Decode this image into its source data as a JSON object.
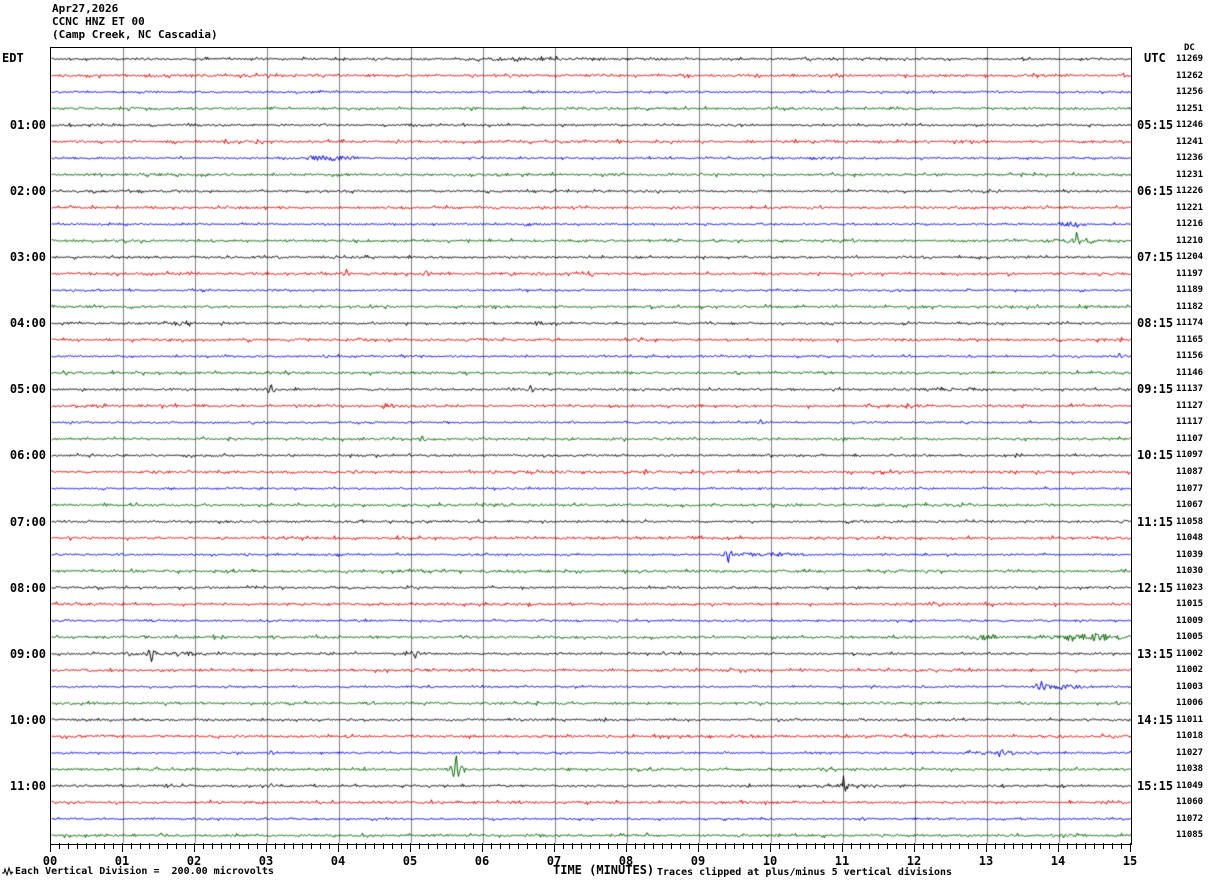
{
  "header": {
    "date": "Apr27,2026",
    "station": "CCNC HNZ ET 00",
    "location": "(Camp Creek, NC Cascadia)"
  },
  "axis": {
    "left_header": "EDT",
    "right_header": "UTC",
    "dc_header": "DC",
    "x_label": "TIME (MINUTES)",
    "footer_scale": "Each Vertical Division =  200.00 microvolts",
    "footer_clip": "Traces clipped at plus/minus 5 vertical divisions"
  },
  "chart_data": {
    "type": "line",
    "subtype": "helicorder-seismogram",
    "title": "CCNC HNZ ET 00 (Camp Creek, NC Cascadia) Apr27,2026",
    "xlabel": "TIME (MINUTES)",
    "x_range_minutes": [
      0,
      15
    ],
    "x_tick_labels": [
      "00",
      "01",
      "02",
      "03",
      "04",
      "05",
      "06",
      "07",
      "08",
      "09",
      "10",
      "11",
      "12",
      "13",
      "14",
      "15"
    ],
    "minor_ticks_per_interval": 7,
    "minutes_per_row": 15,
    "microvolts_per_division": 200.0,
    "clip_divisions": 5,
    "grid": true,
    "colors": {
      "black": "#000000",
      "red": "#dd0000",
      "blue": "#0000dd",
      "green": "#006400",
      "grid": "#808080"
    },
    "color_cycle": [
      "black",
      "red",
      "blue",
      "green"
    ],
    "rows": [
      {
        "edt": "",
        "utc": "",
        "dc": 11269
      },
      {
        "edt": "",
        "utc": "",
        "dc": 11262
      },
      {
        "edt": "",
        "utc": "",
        "dc": 11256
      },
      {
        "edt": "",
        "utc": "",
        "dc": 11251
      },
      {
        "edt": "01:00",
        "utc": "05:15",
        "dc": 11246
      },
      {
        "edt": "",
        "utc": "",
        "dc": 11241
      },
      {
        "edt": "",
        "utc": "",
        "dc": 11236
      },
      {
        "edt": "",
        "utc": "",
        "dc": 11231
      },
      {
        "edt": "02:00",
        "utc": "06:15",
        "dc": 11226
      },
      {
        "edt": "",
        "utc": "",
        "dc": 11221
      },
      {
        "edt": "",
        "utc": "",
        "dc": 11216
      },
      {
        "edt": "",
        "utc": "",
        "dc": 11210
      },
      {
        "edt": "03:00",
        "utc": "07:15",
        "dc": 11204
      },
      {
        "edt": "",
        "utc": "",
        "dc": 11197
      },
      {
        "edt": "",
        "utc": "",
        "dc": 11189
      },
      {
        "edt": "",
        "utc": "",
        "dc": 11182
      },
      {
        "edt": "04:00",
        "utc": "08:15",
        "dc": 11174
      },
      {
        "edt": "",
        "utc": "",
        "dc": 11165
      },
      {
        "edt": "",
        "utc": "",
        "dc": 11156
      },
      {
        "edt": "",
        "utc": "",
        "dc": 11146
      },
      {
        "edt": "05:00",
        "utc": "09:15",
        "dc": 11137
      },
      {
        "edt": "",
        "utc": "",
        "dc": 11127
      },
      {
        "edt": "",
        "utc": "",
        "dc": 11117
      },
      {
        "edt": "",
        "utc": "",
        "dc": 11107
      },
      {
        "edt": "06:00",
        "utc": "10:15",
        "dc": 11097
      },
      {
        "edt": "",
        "utc": "",
        "dc": 11087
      },
      {
        "edt": "",
        "utc": "",
        "dc": 11077
      },
      {
        "edt": "",
        "utc": "",
        "dc": 11067
      },
      {
        "edt": "07:00",
        "utc": "11:15",
        "dc": 11058
      },
      {
        "edt": "",
        "utc": "",
        "dc": 11048
      },
      {
        "edt": "",
        "utc": "",
        "dc": 11039
      },
      {
        "edt": "",
        "utc": "",
        "dc": 11030
      },
      {
        "edt": "08:00",
        "utc": "12:15",
        "dc": 11023
      },
      {
        "edt": "",
        "utc": "",
        "dc": 11015
      },
      {
        "edt": "",
        "utc": "",
        "dc": 11009
      },
      {
        "edt": "",
        "utc": "",
        "dc": 11005
      },
      {
        "edt": "09:00",
        "utc": "13:15",
        "dc": 11002
      },
      {
        "edt": "",
        "utc": "",
        "dc": 11002
      },
      {
        "edt": "",
        "utc": "",
        "dc": 11003
      },
      {
        "edt": "",
        "utc": "",
        "dc": 11006
      },
      {
        "edt": "10:00",
        "utc": "14:15",
        "dc": 11011
      },
      {
        "edt": "",
        "utc": "",
        "dc": 11018
      },
      {
        "edt": "",
        "utc": "",
        "dc": 11027
      },
      {
        "edt": "",
        "utc": "",
        "dc": 11038
      },
      {
        "edt": "11:00",
        "utc": "15:15",
        "dc": 11049
      },
      {
        "edt": "",
        "utc": "",
        "dc": 11060
      },
      {
        "edt": "",
        "utc": "",
        "dc": 11072
      },
      {
        "edt": "",
        "utc": "",
        "dc": 11085
      }
    ],
    "events": [
      {
        "row": 1,
        "type": "sym",
        "t0": 5.3,
        "t1": 8.6,
        "amp": 1.2
      },
      {
        "row": 2,
        "type": "sym",
        "t0": 1.65,
        "t1": 2.2,
        "amp": 1.4
      },
      {
        "row": 7,
        "type": "sym",
        "t0": 3.45,
        "t1": 4.3,
        "amp": 2.6
      },
      {
        "row": 7,
        "type": "sym",
        "t0": 10.4,
        "t1": 10.75,
        "amp": 1.8
      },
      {
        "row": 11,
        "type": "sym",
        "t0": 13.95,
        "t1": 14.4,
        "amp": 2.4
      },
      {
        "row": 12,
        "type": "sym",
        "t0": 7.3,
        "t1": 7.6,
        "amp": 1.8
      },
      {
        "row": 12,
        "type": "sym",
        "t0": 13.9,
        "t1": 14.6,
        "amp": 2.0
      },
      {
        "row": 12,
        "type": "spike",
        "t0": 14.24,
        "amp": 7
      },
      {
        "row": 14,
        "type": "spike",
        "t0": 4.1,
        "amp": 4.5
      },
      {
        "row": 14,
        "type": "spike",
        "t0": 5.2,
        "amp": 5
      },
      {
        "row": 17,
        "type": "sym",
        "t0": 1.55,
        "t1": 1.95,
        "amp": 1.8
      },
      {
        "row": 17,
        "type": "sym",
        "t0": 6.55,
        "t1": 6.95,
        "amp": 1.6
      },
      {
        "row": 17,
        "type": "sym",
        "t0": 11.65,
        "t1": 12.05,
        "amp": 1.6
      },
      {
        "row": 19,
        "type": "spike",
        "t0": 14.83,
        "amp": 3.5
      },
      {
        "row": 21,
        "type": "spike",
        "t0": 3.05,
        "amp": 6
      },
      {
        "row": 21,
        "type": "spike",
        "t0": 6.65,
        "amp": 4
      },
      {
        "row": 21,
        "type": "sym",
        "t0": 11.8,
        "t1": 13.1,
        "amp": 1.4
      },
      {
        "row": 22,
        "type": "decay",
        "t0": 4.6,
        "t1": 5.15,
        "amp": 3.2
      },
      {
        "row": 23,
        "type": "spike",
        "t0": 9.85,
        "amp": 3
      },
      {
        "row": 24,
        "type": "spike",
        "t0": 5.15,
        "amp": 3
      },
      {
        "row": 31,
        "type": "spike",
        "t0": 9.4,
        "amp": -7
      },
      {
        "row": 31,
        "type": "sym",
        "t0": 9.35,
        "t1": 10.6,
        "amp": 2.0
      },
      {
        "row": 36,
        "type": "sym",
        "t0": 12.7,
        "t1": 13.2,
        "amp": 2.8
      },
      {
        "row": 36,
        "type": "sym",
        "t0": 13.2,
        "t1": 15.0,
        "amp": 1.6
      },
      {
        "row": 36,
        "type": "sym",
        "t0": 14.0,
        "t1": 15.0,
        "amp": 3.4
      },
      {
        "row": 37,
        "type": "sym",
        "t0": 1.05,
        "t1": 2.2,
        "amp": 2.0
      },
      {
        "row": 37,
        "type": "spike",
        "t0": 1.39,
        "amp": -7
      },
      {
        "row": 37,
        "type": "decay",
        "t0": 4.9,
        "t1": 5.45,
        "amp": 3.6
      },
      {
        "row": 37,
        "type": "spike",
        "t0": 5.05,
        "amp": -5
      },
      {
        "row": 39,
        "type": "sym",
        "t0": 13.55,
        "t1": 14.5,
        "amp": 2.2
      },
      {
        "row": 39,
        "type": "spike",
        "t0": 13.75,
        "amp": 5
      },
      {
        "row": 41,
        "type": "sym",
        "t0": 11.1,
        "t1": 11.4,
        "amp": 1.4
      },
      {
        "row": 43,
        "type": "spike",
        "t0": 3.05,
        "amp": 2.2
      },
      {
        "row": 43,
        "type": "sym",
        "t0": 12.65,
        "t1": 13.5,
        "amp": 1.8
      },
      {
        "row": 43,
        "type": "spike",
        "t0": 13.2,
        "amp": 5
      },
      {
        "row": 44,
        "type": "spike",
        "t0": 5.62,
        "amp": 16
      },
      {
        "row": 44,
        "type": "decay",
        "t0": 5.62,
        "t1": 6.0,
        "amp": 3
      },
      {
        "row": 45,
        "type": "spike",
        "t0": 3.05,
        "amp": 2.5
      },
      {
        "row": 45,
        "type": "decay",
        "t0": 10.95,
        "t1": 11.7,
        "amp": 5.5
      },
      {
        "row": 45,
        "type": "spike",
        "t0": 11.0,
        "amp": 8
      }
    ]
  }
}
